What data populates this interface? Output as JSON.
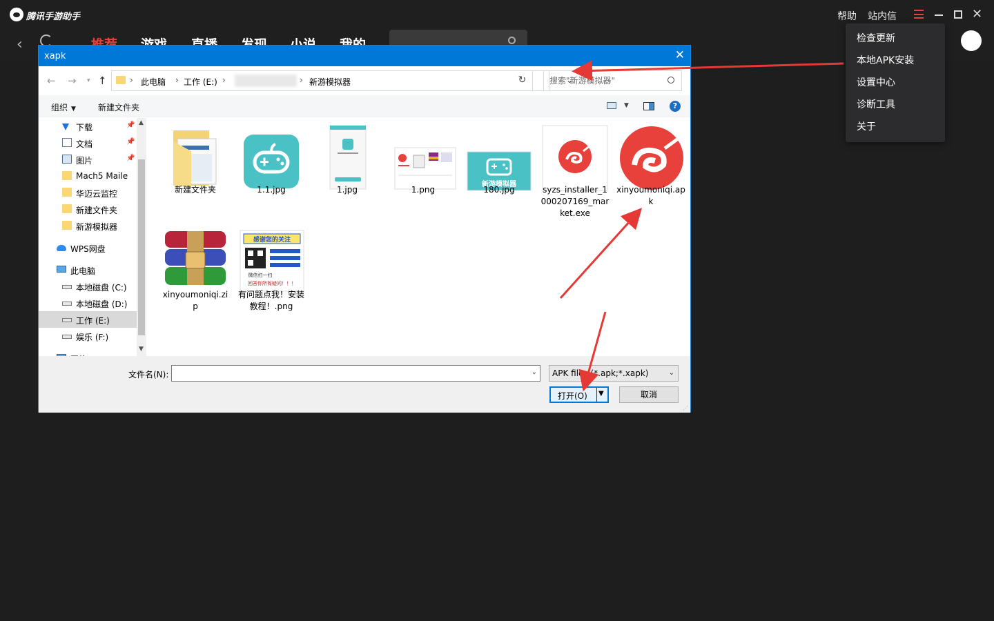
{
  "app": {
    "name": "腾讯手游助手",
    "top_links": [
      "帮助",
      "站内信"
    ],
    "nav_tabs": [
      "推荐",
      "游戏",
      "直播",
      "发现",
      "小说",
      "我的"
    ],
    "active_tab": 0,
    "menu": [
      "检查更新",
      "本地APK安装",
      "设置中心",
      "诊断工具",
      "关于"
    ],
    "accent_color": "#e8413b"
  },
  "dialog": {
    "title": "xapk",
    "close_symbol": "✕",
    "breadcrumb": [
      "此电脑",
      "工作 (E:)",
      "新游模拟器"
    ],
    "search_placeholder": "搜索\"新游模拟器\"",
    "toolbar": {
      "organize": "组织",
      "new_folder": "新建文件夹"
    },
    "nav_tree": [
      {
        "label": "下载",
        "icon": "download-icon",
        "pinned": true
      },
      {
        "label": "文档",
        "icon": "document-icon",
        "pinned": true
      },
      {
        "label": "图片",
        "icon": "pictures-icon",
        "pinned": true
      },
      {
        "label": "Mach5 Maile",
        "icon": "folder-icon",
        "pinned": false
      },
      {
        "label": "华迈云监控",
        "icon": "folder-icon",
        "pinned": false
      },
      {
        "label": "新建文件夹",
        "icon": "folder-icon",
        "pinned": false
      },
      {
        "label": "新游模拟器",
        "icon": "folder-icon",
        "pinned": false
      },
      {
        "label": "WPS网盘",
        "icon": "cloud-icon",
        "pinned": false
      },
      {
        "label": "此电脑",
        "icon": "computer-icon",
        "pinned": false
      },
      {
        "label": "本地磁盘 (C:)",
        "icon": "drive-icon",
        "pinned": false
      },
      {
        "label": "本地磁盘 (D:)",
        "icon": "drive-icon",
        "pinned": false
      },
      {
        "label": "工作 (E:)",
        "icon": "drive-icon",
        "pinned": false,
        "selected": true
      },
      {
        "label": "娱乐 (F:)",
        "icon": "drive-icon",
        "pinned": false
      },
      {
        "label": "网络",
        "icon": "network-icon",
        "pinned": false
      }
    ],
    "files": [
      {
        "name": "新建文件夹",
        "type": "folder"
      },
      {
        "name": "1.1.jpg",
        "type": "image-gamepad"
      },
      {
        "name": "1.jpg",
        "type": "image-phone"
      },
      {
        "name": "1.png",
        "type": "image-screenshot"
      },
      {
        "name": "180.jpg",
        "type": "image-gamepad-label"
      },
      {
        "name": "syzs_installer_1000207169_market.exe",
        "type": "exe"
      },
      {
        "name": "xinyoumoniqi.apk",
        "type": "apk"
      },
      {
        "name": "xinyoumoniqi.zip",
        "type": "zip"
      },
      {
        "name": "有问题点我！安装教程！.png",
        "type": "image-qr"
      }
    ],
    "thumb_texts": {
      "gamepad_label": "新游模拟器",
      "qr_header": "感谢您的关注",
      "qr_footer1": "微信扫一扫",
      "qr_footer2": "回答你所有疑问！！！"
    },
    "filename_label": "文件名(N):",
    "filename_value": "",
    "filetype": "APK files (*.apk;*.xapk)",
    "open_label": "打开(O)",
    "cancel_label": "取消"
  }
}
